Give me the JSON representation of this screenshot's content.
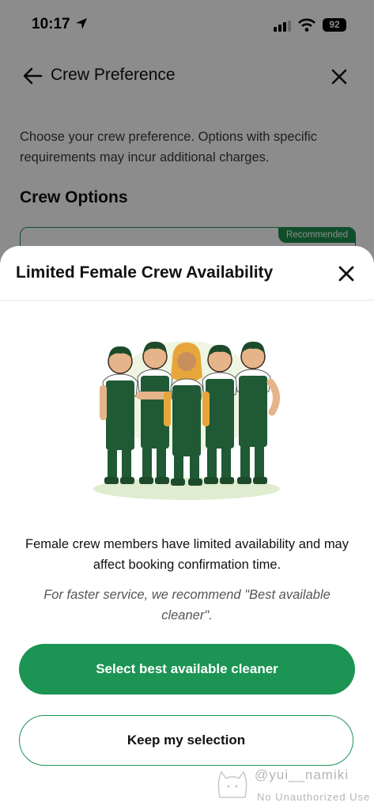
{
  "status_bar": {
    "time": "10:17",
    "battery": "92"
  },
  "header": {
    "title": "Crew Preference"
  },
  "intro_text": "Choose your crew preference. Options with specific requirements may incur additional charges.",
  "section_title": "Crew Options",
  "option_card": {
    "badge": "Recommended"
  },
  "sheet": {
    "title": "Limited Female Crew Availability",
    "message": "Female crew members have limited availability and may affect booking confirmation time.",
    "tip": "For faster service, we recommend \"Best available cleaner\".",
    "primary_button": "Select best available cleaner",
    "secondary_button": "Keep my selection"
  },
  "watermark": {
    "handle": "@yui__namiki",
    "note": "No Unauthorized Use"
  },
  "colors": {
    "accent": "#1c9454",
    "uniform": "#1f5a35",
    "hijab": "#e8a63a"
  }
}
